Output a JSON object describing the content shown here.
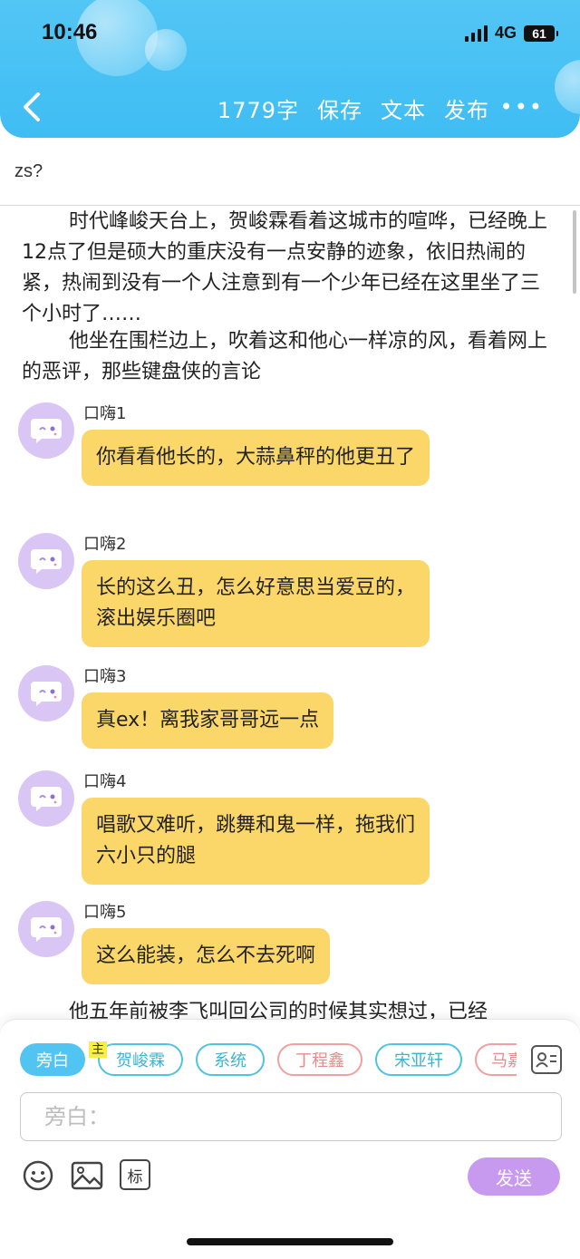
{
  "status_bar": {
    "time": "10:46",
    "network": "4G",
    "battery": "61"
  },
  "toolbar": {
    "word_count": "1779字",
    "save": "保存",
    "text": "文本",
    "publish": "发布",
    "more": "•••"
  },
  "title": "zs?",
  "content": {
    "paragraph_1": "时代峰峻天台上，贺峻霖看着这城市的喧哗，已经晚上12点了但是硕大的重庆没有一点安静的迹象，依旧热闹的紧，热闹到没有一个人注意到有一个少年已经在这里坐了三个小时了……",
    "paragraph_2": "他坐在围栏边上，吹着这和他心一样凉的风，看着网上的恶评，那些键盘侠的言论",
    "messages": [
      {
        "name": "口嗨1",
        "text": "你看看他长的，大蒜鼻秤的他更丑了"
      },
      {
        "name": "口嗨2",
        "text": "长的这么丑，怎么好意思当爱豆的，滚出娱乐圈吧"
      },
      {
        "name": "口嗨3",
        "text": "真ex！离我家哥哥远一点"
      },
      {
        "name": "口嗨4",
        "text": "唱歌又难听，跳舞和鬼一样，拖我们六小只的腿"
      },
      {
        "name": "口嗨5",
        "text": "这么能装，怎么不去死啊"
      }
    ],
    "paragraph_3_partial": "他五年前被李飞叫回公司的时候其实想过，已经"
  },
  "roles": {
    "badge": "主",
    "items": [
      "旁白",
      "贺峻霖",
      "系统",
      "丁程鑫",
      "宋亚轩",
      "马嘉"
    ],
    "colors": {
      "active": "#52c4f2",
      "cyan": "#4fc3e0",
      "red": "#f0a0a0"
    }
  },
  "composer": {
    "placeholder": "旁白：",
    "tag_button": "标",
    "send": "发送"
  }
}
